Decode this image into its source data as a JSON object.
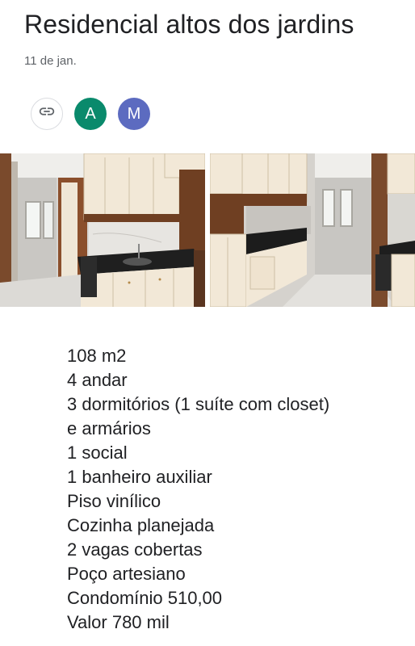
{
  "post": {
    "title": "Residencial altos dos jardins",
    "date": "11 de jan."
  },
  "chips": [
    {
      "icon": "link-icon"
    },
    {
      "letter": "A",
      "color": "#0a8a6c"
    },
    {
      "letter": "M",
      "color": "#5c6bc0"
    }
  ],
  "photos": [
    {
      "icon": "kitchen-photo"
    },
    {
      "icon": "kitchen-photo"
    }
  ],
  "details": [
    "108 m2",
    "4 andar",
    "3 dormitórios (1 suíte com closet) e armários",
    "1 social",
    "1 banheiro auxiliar",
    "Piso vinílico",
    "Cozinha planejada",
    "2 vagas cobertas",
    "Poço artesiano",
    "Condomínio 510,00",
    "Valor 780 mil"
  ]
}
